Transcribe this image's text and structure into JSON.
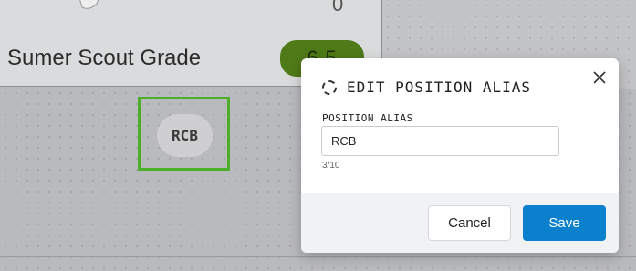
{
  "card": {
    "top_value": "0",
    "grade_label": "Sumer Scout Grade",
    "grade_value": "6.5",
    "grade_color": "#4e7a17"
  },
  "field_position": {
    "selected_label": "RCB",
    "selection_color": "#4caf2a"
  },
  "dialog": {
    "title_icon": "dashed-circle-icon",
    "title": "EDIT POSITION ALIAS",
    "close_icon": "close-icon",
    "field_label": "POSITION ALIAS",
    "field_value": "RCB",
    "counter": "3/10",
    "cancel_label": "Cancel",
    "save_label": "Save",
    "save_color": "#0b80cc"
  }
}
